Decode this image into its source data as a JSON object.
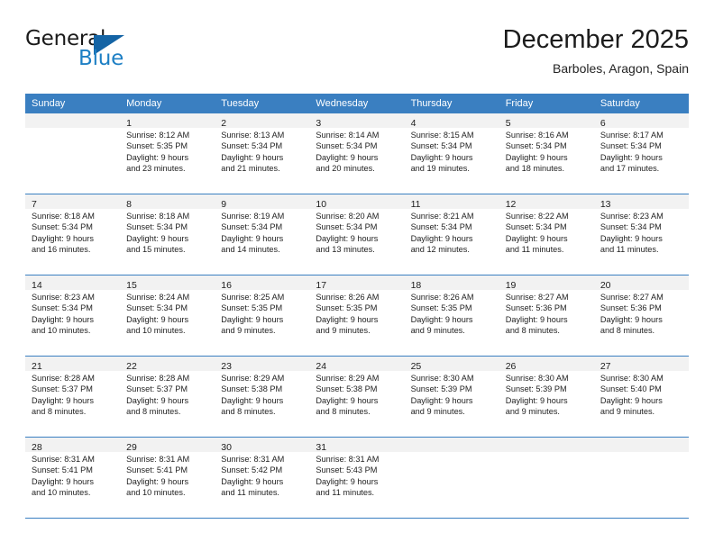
{
  "brand": {
    "name_part1": "General",
    "name_part2": "Blue",
    "triangle_color": "#1464a5",
    "blue_color": "#1d7fc4"
  },
  "header": {
    "title": "December 2025",
    "subtitle": "Barboles, Aragon, Spain"
  },
  "theme": {
    "header_bg": "#3a7fc1",
    "header_text": "#ffffff",
    "daynum_bg": "#f2f2f2",
    "body_text": "#1f1f1f"
  },
  "weekdays": [
    "Sunday",
    "Monday",
    "Tuesday",
    "Wednesday",
    "Thursday",
    "Friday",
    "Saturday"
  ],
  "labels": {
    "sunrise_prefix": "Sunrise:",
    "sunset_prefix": "Sunset:",
    "daylight_prefix": "Daylight:"
  },
  "weeks": [
    [
      {
        "day": "",
        "sunrise": "",
        "sunset": "",
        "daylight_line1": "",
        "daylight_line2": ""
      },
      {
        "day": "1",
        "sunrise": "Sunrise: 8:12 AM",
        "sunset": "Sunset: 5:35 PM",
        "daylight_line1": "Daylight: 9 hours",
        "daylight_line2": "and 23 minutes."
      },
      {
        "day": "2",
        "sunrise": "Sunrise: 8:13 AM",
        "sunset": "Sunset: 5:34 PM",
        "daylight_line1": "Daylight: 9 hours",
        "daylight_line2": "and 21 minutes."
      },
      {
        "day": "3",
        "sunrise": "Sunrise: 8:14 AM",
        "sunset": "Sunset: 5:34 PM",
        "daylight_line1": "Daylight: 9 hours",
        "daylight_line2": "and 20 minutes."
      },
      {
        "day": "4",
        "sunrise": "Sunrise: 8:15 AM",
        "sunset": "Sunset: 5:34 PM",
        "daylight_line1": "Daylight: 9 hours",
        "daylight_line2": "and 19 minutes."
      },
      {
        "day": "5",
        "sunrise": "Sunrise: 8:16 AM",
        "sunset": "Sunset: 5:34 PM",
        "daylight_line1": "Daylight: 9 hours",
        "daylight_line2": "and 18 minutes."
      },
      {
        "day": "6",
        "sunrise": "Sunrise: 8:17 AM",
        "sunset": "Sunset: 5:34 PM",
        "daylight_line1": "Daylight: 9 hours",
        "daylight_line2": "and 17 minutes."
      }
    ],
    [
      {
        "day": "7",
        "sunrise": "Sunrise: 8:18 AM",
        "sunset": "Sunset: 5:34 PM",
        "daylight_line1": "Daylight: 9 hours",
        "daylight_line2": "and 16 minutes."
      },
      {
        "day": "8",
        "sunrise": "Sunrise: 8:18 AM",
        "sunset": "Sunset: 5:34 PM",
        "daylight_line1": "Daylight: 9 hours",
        "daylight_line2": "and 15 minutes."
      },
      {
        "day": "9",
        "sunrise": "Sunrise: 8:19 AM",
        "sunset": "Sunset: 5:34 PM",
        "daylight_line1": "Daylight: 9 hours",
        "daylight_line2": "and 14 minutes."
      },
      {
        "day": "10",
        "sunrise": "Sunrise: 8:20 AM",
        "sunset": "Sunset: 5:34 PM",
        "daylight_line1": "Daylight: 9 hours",
        "daylight_line2": "and 13 minutes."
      },
      {
        "day": "11",
        "sunrise": "Sunrise: 8:21 AM",
        "sunset": "Sunset: 5:34 PM",
        "daylight_line1": "Daylight: 9 hours",
        "daylight_line2": "and 12 minutes."
      },
      {
        "day": "12",
        "sunrise": "Sunrise: 8:22 AM",
        "sunset": "Sunset: 5:34 PM",
        "daylight_line1": "Daylight: 9 hours",
        "daylight_line2": "and 11 minutes."
      },
      {
        "day": "13",
        "sunrise": "Sunrise: 8:23 AM",
        "sunset": "Sunset: 5:34 PM",
        "daylight_line1": "Daylight: 9 hours",
        "daylight_line2": "and 11 minutes."
      }
    ],
    [
      {
        "day": "14",
        "sunrise": "Sunrise: 8:23 AM",
        "sunset": "Sunset: 5:34 PM",
        "daylight_line1": "Daylight: 9 hours",
        "daylight_line2": "and 10 minutes."
      },
      {
        "day": "15",
        "sunrise": "Sunrise: 8:24 AM",
        "sunset": "Sunset: 5:34 PM",
        "daylight_line1": "Daylight: 9 hours",
        "daylight_line2": "and 10 minutes."
      },
      {
        "day": "16",
        "sunrise": "Sunrise: 8:25 AM",
        "sunset": "Sunset: 5:35 PM",
        "daylight_line1": "Daylight: 9 hours",
        "daylight_line2": "and 9 minutes."
      },
      {
        "day": "17",
        "sunrise": "Sunrise: 8:26 AM",
        "sunset": "Sunset: 5:35 PM",
        "daylight_line1": "Daylight: 9 hours",
        "daylight_line2": "and 9 minutes."
      },
      {
        "day": "18",
        "sunrise": "Sunrise: 8:26 AM",
        "sunset": "Sunset: 5:35 PM",
        "daylight_line1": "Daylight: 9 hours",
        "daylight_line2": "and 9 minutes."
      },
      {
        "day": "19",
        "sunrise": "Sunrise: 8:27 AM",
        "sunset": "Sunset: 5:36 PM",
        "daylight_line1": "Daylight: 9 hours",
        "daylight_line2": "and 8 minutes."
      },
      {
        "day": "20",
        "sunrise": "Sunrise: 8:27 AM",
        "sunset": "Sunset: 5:36 PM",
        "daylight_line1": "Daylight: 9 hours",
        "daylight_line2": "and 8 minutes."
      }
    ],
    [
      {
        "day": "21",
        "sunrise": "Sunrise: 8:28 AM",
        "sunset": "Sunset: 5:37 PM",
        "daylight_line1": "Daylight: 9 hours",
        "daylight_line2": "and 8 minutes."
      },
      {
        "day": "22",
        "sunrise": "Sunrise: 8:28 AM",
        "sunset": "Sunset: 5:37 PM",
        "daylight_line1": "Daylight: 9 hours",
        "daylight_line2": "and 8 minutes."
      },
      {
        "day": "23",
        "sunrise": "Sunrise: 8:29 AM",
        "sunset": "Sunset: 5:38 PM",
        "daylight_line1": "Daylight: 9 hours",
        "daylight_line2": "and 8 minutes."
      },
      {
        "day": "24",
        "sunrise": "Sunrise: 8:29 AM",
        "sunset": "Sunset: 5:38 PM",
        "daylight_line1": "Daylight: 9 hours",
        "daylight_line2": "and 8 minutes."
      },
      {
        "day": "25",
        "sunrise": "Sunrise: 8:30 AM",
        "sunset": "Sunset: 5:39 PM",
        "daylight_line1": "Daylight: 9 hours",
        "daylight_line2": "and 9 minutes."
      },
      {
        "day": "26",
        "sunrise": "Sunrise: 8:30 AM",
        "sunset": "Sunset: 5:39 PM",
        "daylight_line1": "Daylight: 9 hours",
        "daylight_line2": "and 9 minutes."
      },
      {
        "day": "27",
        "sunrise": "Sunrise: 8:30 AM",
        "sunset": "Sunset: 5:40 PM",
        "daylight_line1": "Daylight: 9 hours",
        "daylight_line2": "and 9 minutes."
      }
    ],
    [
      {
        "day": "28",
        "sunrise": "Sunrise: 8:31 AM",
        "sunset": "Sunset: 5:41 PM",
        "daylight_line1": "Daylight: 9 hours",
        "daylight_line2": "and 10 minutes."
      },
      {
        "day": "29",
        "sunrise": "Sunrise: 8:31 AM",
        "sunset": "Sunset: 5:41 PM",
        "daylight_line1": "Daylight: 9 hours",
        "daylight_line2": "and 10 minutes."
      },
      {
        "day": "30",
        "sunrise": "Sunrise: 8:31 AM",
        "sunset": "Sunset: 5:42 PM",
        "daylight_line1": "Daylight: 9 hours",
        "daylight_line2": "and 11 minutes."
      },
      {
        "day": "31",
        "sunrise": "Sunrise: 8:31 AM",
        "sunset": "Sunset: 5:43 PM",
        "daylight_line1": "Daylight: 9 hours",
        "daylight_line2": "and 11 minutes."
      },
      {
        "day": "",
        "sunrise": "",
        "sunset": "",
        "daylight_line1": "",
        "daylight_line2": ""
      },
      {
        "day": "",
        "sunrise": "",
        "sunset": "",
        "daylight_line1": "",
        "daylight_line2": ""
      },
      {
        "day": "",
        "sunrise": "",
        "sunset": "",
        "daylight_line1": "",
        "daylight_line2": ""
      }
    ]
  ]
}
